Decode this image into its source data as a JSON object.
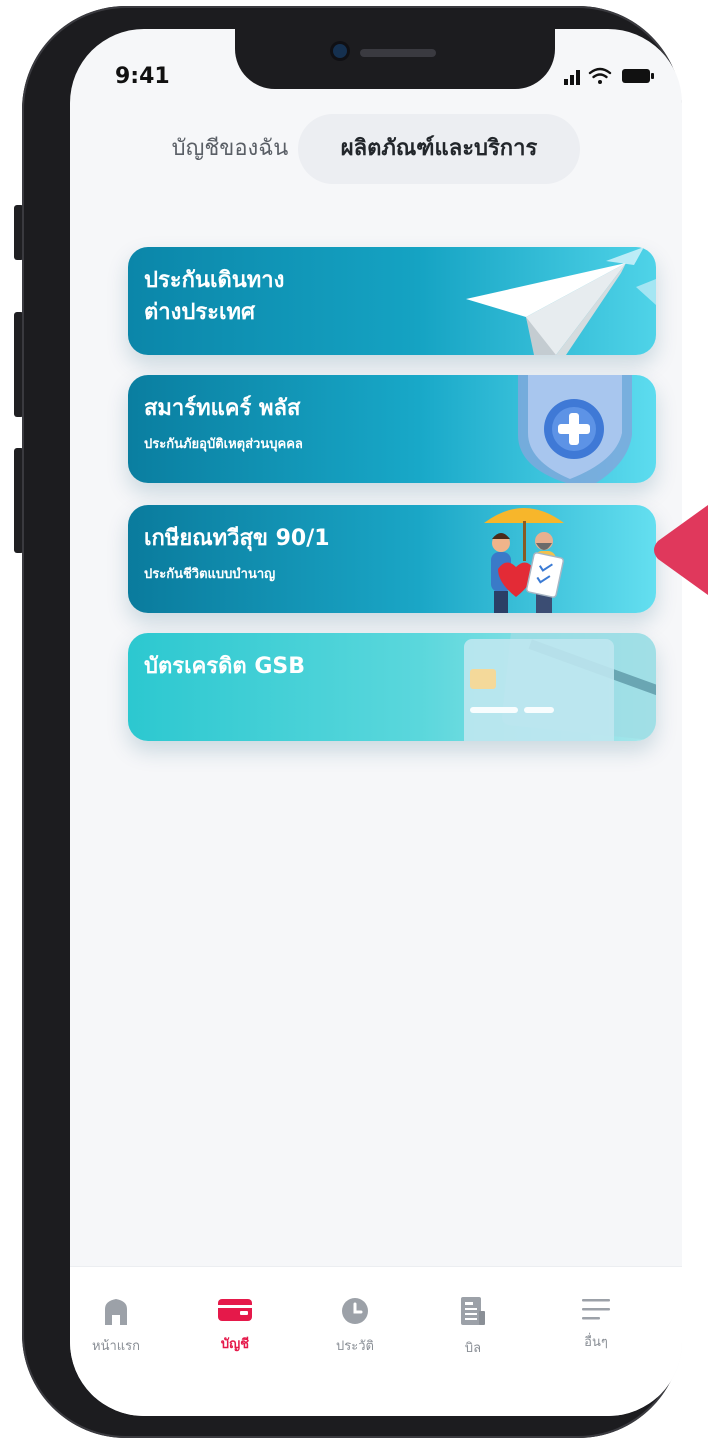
{
  "status_bar": {
    "time": "9:41"
  },
  "tabs": [
    {
      "label": "บัญชีของฉัน",
      "active": false
    },
    {
      "label": "ผลิตภัณฑ์และบริการ",
      "active": true
    }
  ],
  "cards": [
    {
      "title": "ประกันเดินทาง\nต่างประเทศ",
      "subtitle": "",
      "icon": "paper-plane-icon"
    },
    {
      "title": "สมาร์ทแคร์ พลัส",
      "subtitle": "ประกันภัยอุบัติเหตุส่วนบุคคล",
      "icon": "shield-plus-icon"
    },
    {
      "title": "เกษียณทวีสุข 90/1",
      "subtitle": "ประกันชีวิตแบบบำนาญ",
      "icon": "retirement-couple-icon"
    },
    {
      "title": "บัตรเครดิต GSB",
      "subtitle": "",
      "icon": "credit-card-icon"
    }
  ],
  "nav": [
    {
      "label": "หน้าแรก",
      "icon": "home-icon",
      "active": false
    },
    {
      "label": "บัญชี",
      "icon": "wallet-icon",
      "active": true
    },
    {
      "label": "ประวัติ",
      "icon": "clock-icon",
      "active": false
    },
    {
      "label": "บิล",
      "icon": "bill-icon",
      "active": false
    },
    {
      "label": "อื่นๆ",
      "icon": "menu-icon",
      "active": false
    }
  ],
  "colors": {
    "accent": "#e5194a",
    "card_teal_dark": "#0b86a9",
    "card_teal_light": "#4fd3e8",
    "pointer": "#e0385c"
  }
}
